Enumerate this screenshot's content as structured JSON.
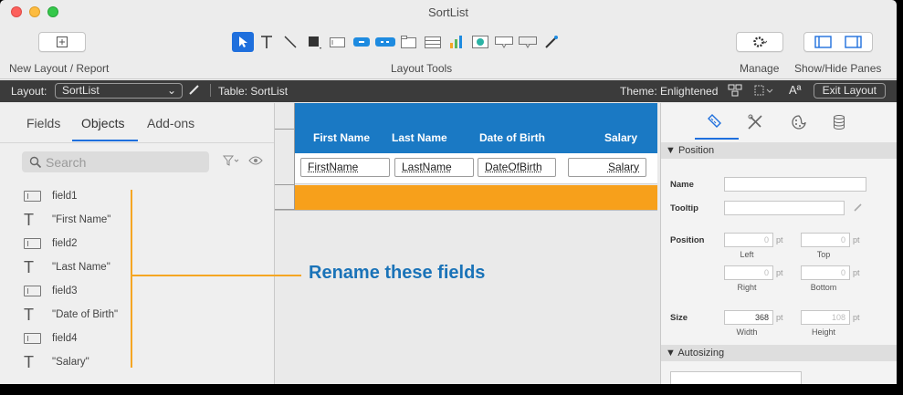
{
  "window": {
    "title": "SortList"
  },
  "toolbar": {
    "new_layout_label": "New Layout / Report",
    "layout_tools_label": "Layout Tools",
    "manage_label": "Manage",
    "show_hide_label": "Show/Hide Panes",
    "tools": [
      "select-pointer-icon",
      "text-tool-icon",
      "line-tool-icon",
      "shape-tool-icon",
      "field-tool-icon",
      "button-tool-icon",
      "button-bar-icon",
      "tab-control-icon",
      "portal-tool-icon",
      "chart-tool-icon",
      "web-viewer-icon",
      "popover-button-icon",
      "popover-icon",
      "format-painter-icon"
    ],
    "accent": "#1e6fdd"
  },
  "layoutbar": {
    "layout_label": "Layout:",
    "layout_value": "SortList",
    "table_label": "Table: SortList",
    "theme_label": "Theme: Enlightened",
    "exit_label": "Exit Layout"
  },
  "leftpane": {
    "tabs": [
      "Fields",
      "Objects",
      "Add-ons"
    ],
    "active_tab": "Objects",
    "search_placeholder": "Search",
    "items": [
      {
        "type": "field",
        "label": "field1"
      },
      {
        "type": "text",
        "label": "\"First Name\""
      },
      {
        "type": "field",
        "label": "field2"
      },
      {
        "type": "text",
        "label": "\"Last Name\""
      },
      {
        "type": "field",
        "label": "field3"
      },
      {
        "type": "text",
        "label": "\"Date of Birth\""
      },
      {
        "type": "field",
        "label": "field4"
      },
      {
        "type": "text",
        "label": "\"Salary\""
      }
    ]
  },
  "canvas": {
    "headers": [
      "First Name",
      "Last Name",
      "Date of Birth",
      "Salary"
    ],
    "fields": [
      "FirstName",
      "LastName",
      "DateOfBirth",
      "Salary"
    ],
    "header_color": "#1a79c4",
    "footer_color": "#f7a01b"
  },
  "annotation": {
    "text": "Rename these fields",
    "line_color": "#f5a623",
    "text_color": "#1a73b8"
  },
  "inspector": {
    "position_section": "▼ Position",
    "name_label": "Name",
    "tooltip_label": "Tooltip",
    "position_label": "Position",
    "left_value": "0",
    "top_value": "0",
    "right_value": "0",
    "bottom_value": "0",
    "unit": "pt",
    "left_label": "Left",
    "top_label": "Top",
    "right_label": "Right",
    "bottom_label": "Bottom",
    "size_label": "Size",
    "width_value": "368",
    "height_value": "108",
    "width_label": "Width",
    "height_label": "Height",
    "autosizing_section": "▼ Autosizing"
  }
}
